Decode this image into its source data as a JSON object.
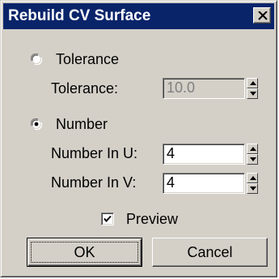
{
  "window": {
    "title": "Rebuild CV Surface",
    "close_icon": "close-icon"
  },
  "tolerance_option": {
    "label": "Tolerance",
    "selected": false,
    "field_label": "Tolerance:",
    "value": "10.0",
    "enabled": false
  },
  "number_option": {
    "label": "Number",
    "selected": true,
    "u_label": "Number In U:",
    "u_value": "4",
    "v_label": "Number In V:",
    "v_value": "4"
  },
  "preview": {
    "label": "Preview",
    "checked": true
  },
  "buttons": {
    "ok_label": "OK",
    "cancel_label": "Cancel"
  },
  "colors": {
    "titlebar": "#0a246a",
    "dialog_face": "#d4d0c8",
    "disabled_text": "#808080"
  }
}
